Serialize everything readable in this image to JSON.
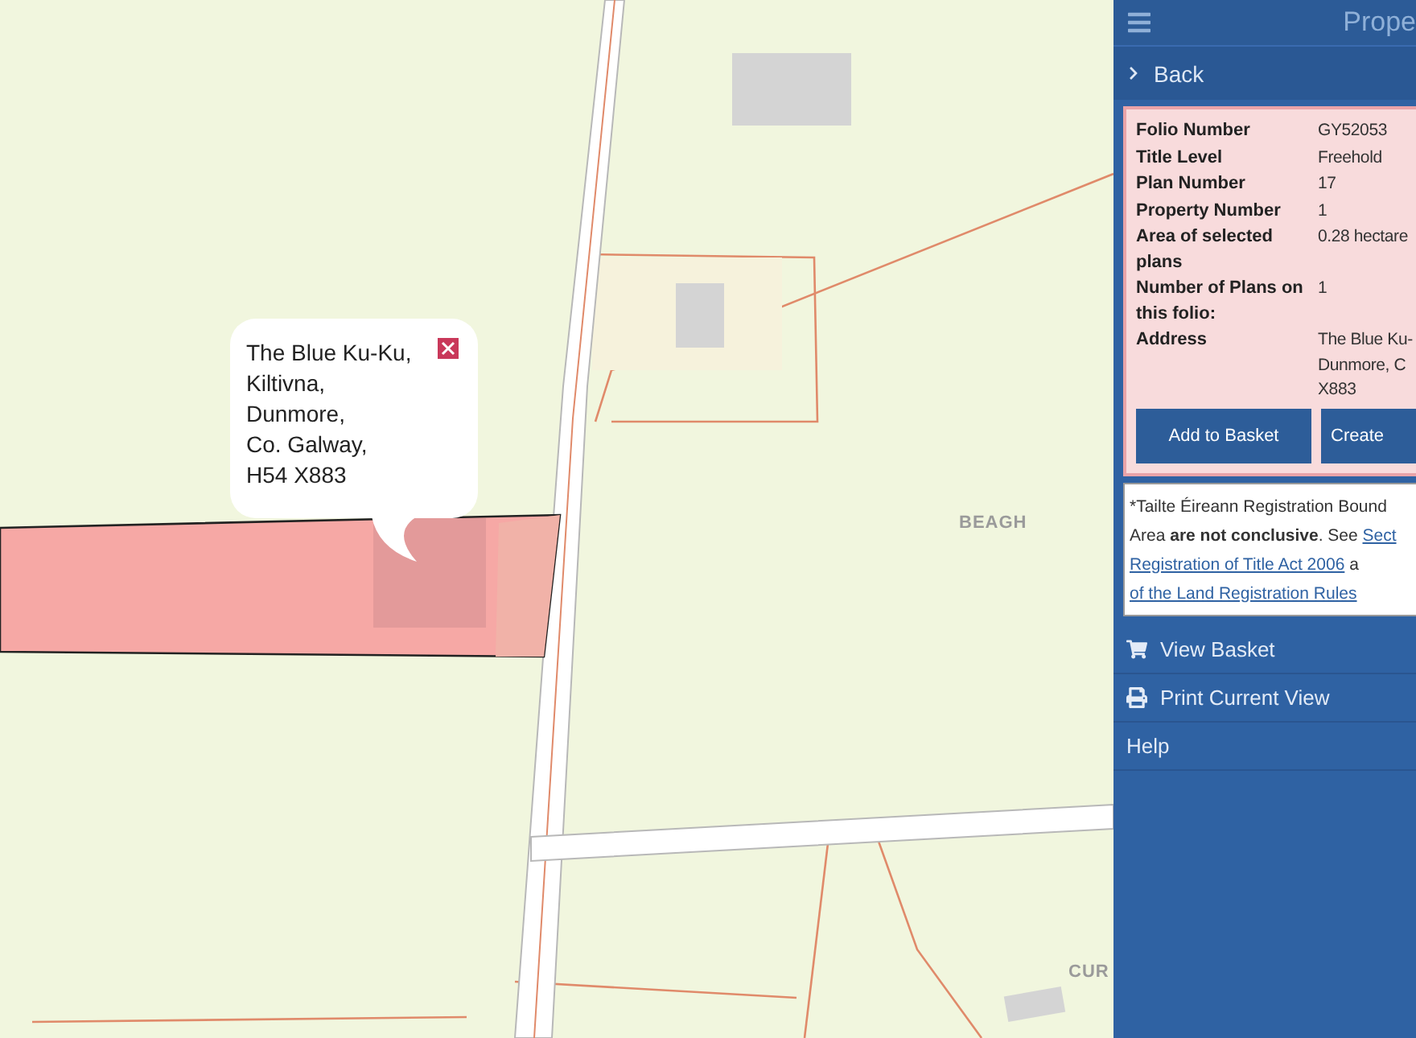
{
  "map": {
    "labels": [
      {
        "text": "BEAGH"
      },
      {
        "text": "CUR"
      }
    ],
    "popup": {
      "lines": [
        "The Blue Ku-Ku,",
        "Kiltivna,",
        "Dunmore,",
        "Co. Galway,",
        "H54 X883"
      ]
    }
  },
  "panel": {
    "title": "Prope",
    "back": "Back",
    "details": [
      {
        "label": "Folio Number",
        "value": [
          "GY52053"
        ]
      },
      {
        "label": "Title Level",
        "value": [
          "Freehold"
        ]
      },
      {
        "label": "Plan Number",
        "value": [
          "17"
        ]
      },
      {
        "label": "Property Number",
        "value": [
          "1"
        ]
      },
      {
        "label": "Area of selected plans",
        "value": [
          "0.28 hectare"
        ]
      },
      {
        "label": "Number of Plans on this folio:",
        "value": [
          "1"
        ]
      },
      {
        "label": "Address",
        "value": [
          "The Blue Ku-",
          "Dunmore, C",
          "X883"
        ]
      }
    ],
    "buttons": [
      "Add to Basket",
      "Create"
    ],
    "notice": [
      [
        {
          "kind": "text",
          "text": "*Tailte Éireann Registration Bound"
        }
      ],
      [
        {
          "kind": "text",
          "text": "Area "
        },
        {
          "kind": "bold",
          "text": "are not conclusive"
        },
        {
          "kind": "text",
          "text": ". See "
        },
        {
          "kind": "link",
          "text": "Sect"
        }
      ],
      [
        {
          "kind": "link",
          "text": "Registration of Title Act 2006"
        },
        {
          "kind": "text",
          "text": " a"
        }
      ],
      [
        {
          "kind": "link",
          "text": "of the Land Registration Rules"
        }
      ]
    ],
    "menu": [
      {
        "kind": "cart",
        "label": "View Basket"
      },
      {
        "kind": "print",
        "label": "Print Current View"
      },
      {
        "kind": "none",
        "label": "Help"
      }
    ]
  }
}
